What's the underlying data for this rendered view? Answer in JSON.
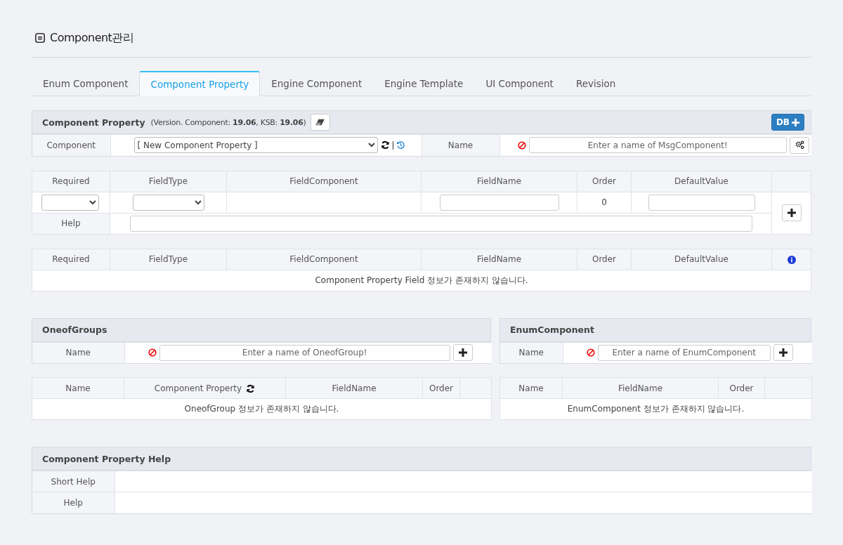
{
  "page_title": "Component관리",
  "tabs": [
    {
      "label": "Enum Component",
      "selected": false
    },
    {
      "label": "Component Property",
      "selected": true
    },
    {
      "label": "Engine Component",
      "selected": false
    },
    {
      "label": "Engine Template",
      "selected": false
    },
    {
      "label": "UI Component",
      "selected": false
    },
    {
      "label": "Revision",
      "selected": false
    }
  ],
  "property_panel": {
    "title": "Component Property",
    "version_note": "(Version. Component: **19.06**, KSB: **19.06**)",
    "db_button": "DB",
    "component_label": "Component",
    "component_select": "[ New Component Property ]",
    "name_label": "Name",
    "name_placeholder": "Enter a name of MsgComponent!"
  },
  "field_editor": {
    "columns": [
      "Required",
      "FieldType",
      "FieldComponent",
      "FieldName",
      "Order",
      "DefaultValue"
    ],
    "order_value": "0",
    "help_label": "Help"
  },
  "field_list": {
    "columns": [
      "Required",
      "FieldType",
      "FieldComponent",
      "FieldName",
      "Order",
      "DefaultValue"
    ],
    "empty_message": "Component Property Field 정보가 존재하지 않습니다."
  },
  "oneof_groups": {
    "title": "OneofGroups",
    "name_label": "Name",
    "name_placeholder": "Enter a name of OneofGroup!",
    "columns": [
      "Name",
      "Component Property",
      "FieldName",
      "Order"
    ],
    "empty_message": "OneofGroup 정보가 존재하지 않습니다."
  },
  "enum_component": {
    "title": "EnumComponent",
    "name_label": "Name",
    "name_placeholder": "Enter a name of EnumComponent",
    "columns": [
      "Name",
      "FieldName",
      "Order"
    ],
    "empty_message": "EnumComponent 정보가 존재하지 않습니다."
  },
  "help_panel": {
    "title": "Component Property Help",
    "rows": [
      {
        "label": "Short Help"
      },
      {
        "label": "Help"
      }
    ]
  }
}
